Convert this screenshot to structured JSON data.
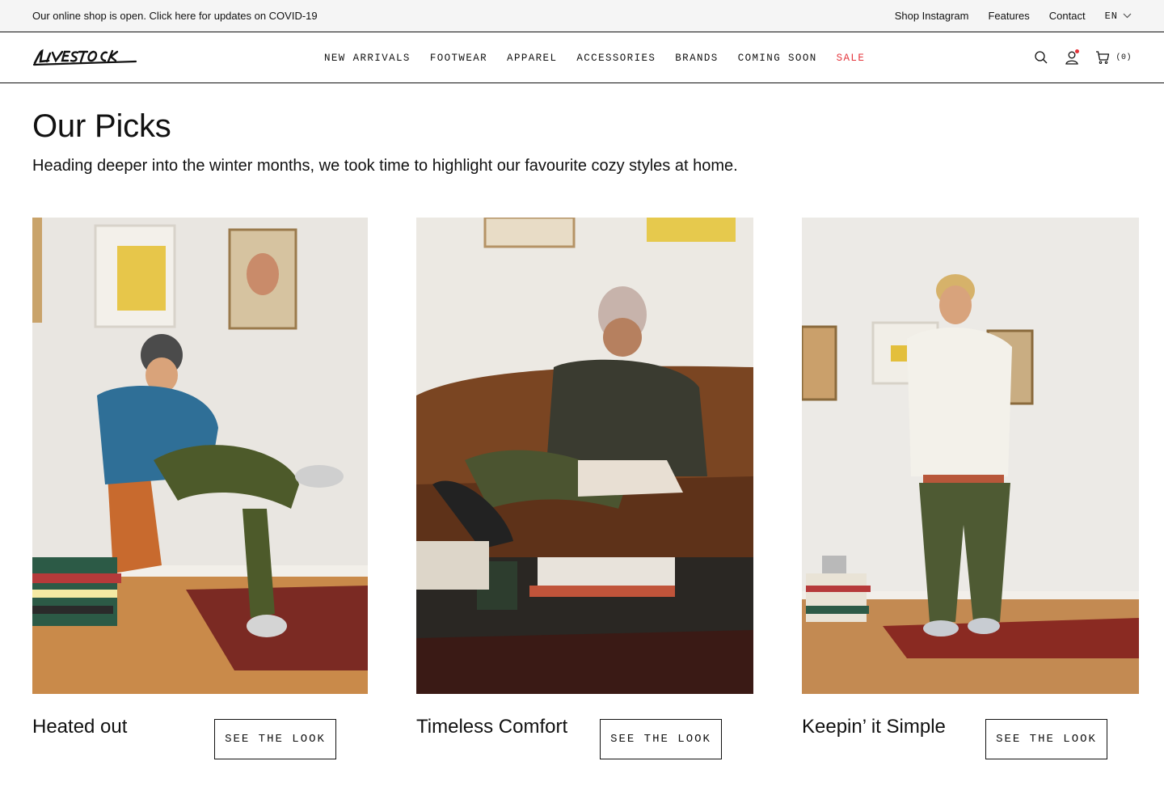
{
  "announcement": {
    "text": "Our online shop is open. Click here for updates on COVID-19",
    "links": [
      "Shop Instagram",
      "Features",
      "Contact"
    ],
    "language": "EN"
  },
  "header": {
    "nav": [
      "NEW ARRIVALS",
      "FOOTWEAR",
      "APPAREL",
      "ACCESSORIES",
      "BRANDS",
      "COMING SOON",
      "SALE"
    ],
    "cart_count": "(0)",
    "colors": {
      "sale": "#e4343b",
      "notification_dot": "#e4343b"
    }
  },
  "main": {
    "title": "Our Picks",
    "subtitle": "Heading deeper into the winter months, we took time to highlight our favourite cozy styles at home.",
    "cards": [
      {
        "caption": "Heated out",
        "button": "SEE THE LOOK"
      },
      {
        "caption": "Timeless Comfort",
        "button": "SEE THE LOOK"
      },
      {
        "caption": "Keepin’ it Simple",
        "button": "SEE THE LOOK"
      }
    ]
  }
}
